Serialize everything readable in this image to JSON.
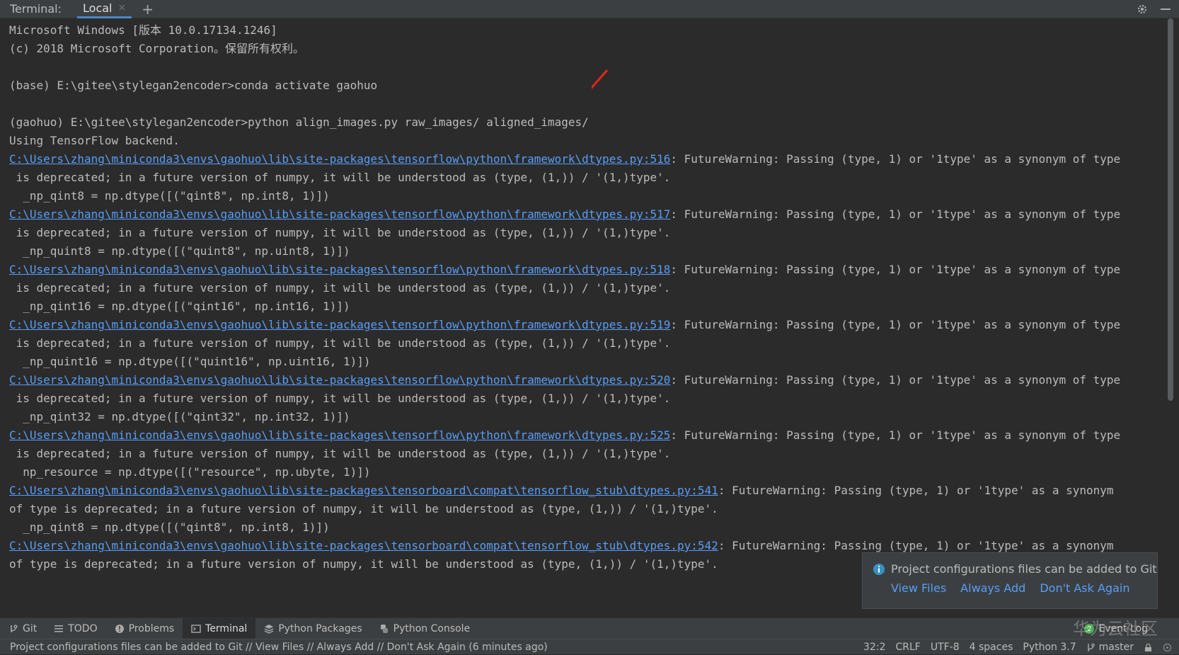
{
  "header": {
    "label": "Terminal:",
    "tab_label": "Local",
    "tab_close": "×",
    "add_tab": "+"
  },
  "terminal": {
    "lines": [
      {
        "text": "Microsoft Windows [版本 10.0.17134.1246]"
      },
      {
        "text": "(c) 2018 Microsoft Corporation。保留所有权利。"
      },
      {
        "text": ""
      },
      {
        "text": "(base) E:\\gitee\\stylegan2encoder>conda activate gaohuo"
      },
      {
        "text": ""
      },
      {
        "text": "(gaohuo) E:\\gitee\\stylegan2encoder>python align_images.py raw_images/ aligned_images/"
      },
      {
        "text": "Using TensorFlow backend."
      },
      {
        "link": "C:\\Users\\zhang\\miniconda3\\envs\\gaohuo\\lib\\site-packages\\tensorflow\\python\\framework\\dtypes.py:516",
        "text": ": FutureWarning: Passing (type, 1) or '1type' as a synonym of type"
      },
      {
        "text": " is deprecated; in a future version of numpy, it will be understood as (type, (1,)) / '(1,)type'."
      },
      {
        "text": "  _np_qint8 = np.dtype([(\"qint8\", np.int8, 1)])"
      },
      {
        "link": "C:\\Users\\zhang\\miniconda3\\envs\\gaohuo\\lib\\site-packages\\tensorflow\\python\\framework\\dtypes.py:517",
        "text": ": FutureWarning: Passing (type, 1) or '1type' as a synonym of type"
      },
      {
        "text": " is deprecated; in a future version of numpy, it will be understood as (type, (1,)) / '(1,)type'."
      },
      {
        "text": "  _np_quint8 = np.dtype([(\"quint8\", np.uint8, 1)])"
      },
      {
        "link": "C:\\Users\\zhang\\miniconda3\\envs\\gaohuo\\lib\\site-packages\\tensorflow\\python\\framework\\dtypes.py:518",
        "text": ": FutureWarning: Passing (type, 1) or '1type' as a synonym of type"
      },
      {
        "text": " is deprecated; in a future version of numpy, it will be understood as (type, (1,)) / '(1,)type'."
      },
      {
        "text": "  _np_qint16 = np.dtype([(\"qint16\", np.int16, 1)])"
      },
      {
        "link": "C:\\Users\\zhang\\miniconda3\\envs\\gaohuo\\lib\\site-packages\\tensorflow\\python\\framework\\dtypes.py:519",
        "text": ": FutureWarning: Passing (type, 1) or '1type' as a synonym of type"
      },
      {
        "text": " is deprecated; in a future version of numpy, it will be understood as (type, (1,)) / '(1,)type'."
      },
      {
        "text": "  _np_quint16 = np.dtype([(\"quint16\", np.uint16, 1)])"
      },
      {
        "link": "C:\\Users\\zhang\\miniconda3\\envs\\gaohuo\\lib\\site-packages\\tensorflow\\python\\framework\\dtypes.py:520",
        "text": ": FutureWarning: Passing (type, 1) or '1type' as a synonym of type"
      },
      {
        "text": " is deprecated; in a future version of numpy, it will be understood as (type, (1,)) / '(1,)type'."
      },
      {
        "text": "  _np_qint32 = np.dtype([(\"qint32\", np.int32, 1)])"
      },
      {
        "link": "C:\\Users\\zhang\\miniconda3\\envs\\gaohuo\\lib\\site-packages\\tensorflow\\python\\framework\\dtypes.py:525",
        "text": ": FutureWarning: Passing (type, 1) or '1type' as a synonym of type"
      },
      {
        "text": " is deprecated; in a future version of numpy, it will be understood as (type, (1,)) / '(1,)type'."
      },
      {
        "text": "  np_resource = np.dtype([(\"resource\", np.ubyte, 1)])"
      },
      {
        "link": "C:\\Users\\zhang\\miniconda3\\envs\\gaohuo\\lib\\site-packages\\tensorboard\\compat\\tensorflow_stub\\dtypes.py:541",
        "text": ": FutureWarning: Passing (type, 1) or '1type' as a synonym"
      },
      {
        "text": "of type is deprecated; in a future version of numpy, it will be understood as (type, (1,)) / '(1,)type'."
      },
      {
        "text": "  _np_qint8 = np.dtype([(\"qint8\", np.int8, 1)])"
      },
      {
        "link": "C:\\Users\\zhang\\miniconda3\\envs\\gaohuo\\lib\\site-packages\\tensorboard\\compat\\tensorflow_stub\\dtypes.py:542",
        "text": ": FutureWarning: Passing (type, 1) or '1type' as a synonym"
      },
      {
        "text": "of type is deprecated; in a future version of numpy, it will be understood as (type, (1,)) / '(1,)type'."
      }
    ]
  },
  "notification": {
    "message": "Project configurations files can be added to Git",
    "action_view": "View Files",
    "action_always": "Always Add",
    "action_never": "Don't Ask Again"
  },
  "toolbar": {
    "items": [
      "Git",
      "TODO",
      "Problems",
      "Terminal",
      "Python Packages",
      "Python Console"
    ],
    "active": "Terminal",
    "event_log": "Event Log",
    "event_count": "2"
  },
  "status": {
    "message": "Project configurations files can be added to Git // View Files // Always Add // Don't Ask Again (6 minutes ago)",
    "position": "32:2",
    "line_sep": "CRLF",
    "encoding": "UTF-8",
    "indent": "4 spaces",
    "interpreter": "Python 3.7",
    "branch": "master"
  },
  "watermark": "华为云社区",
  "colors": {
    "background": "#2b2b2b",
    "link": "#589df6",
    "arrow": "#e8261c",
    "info": "#3592c4"
  }
}
